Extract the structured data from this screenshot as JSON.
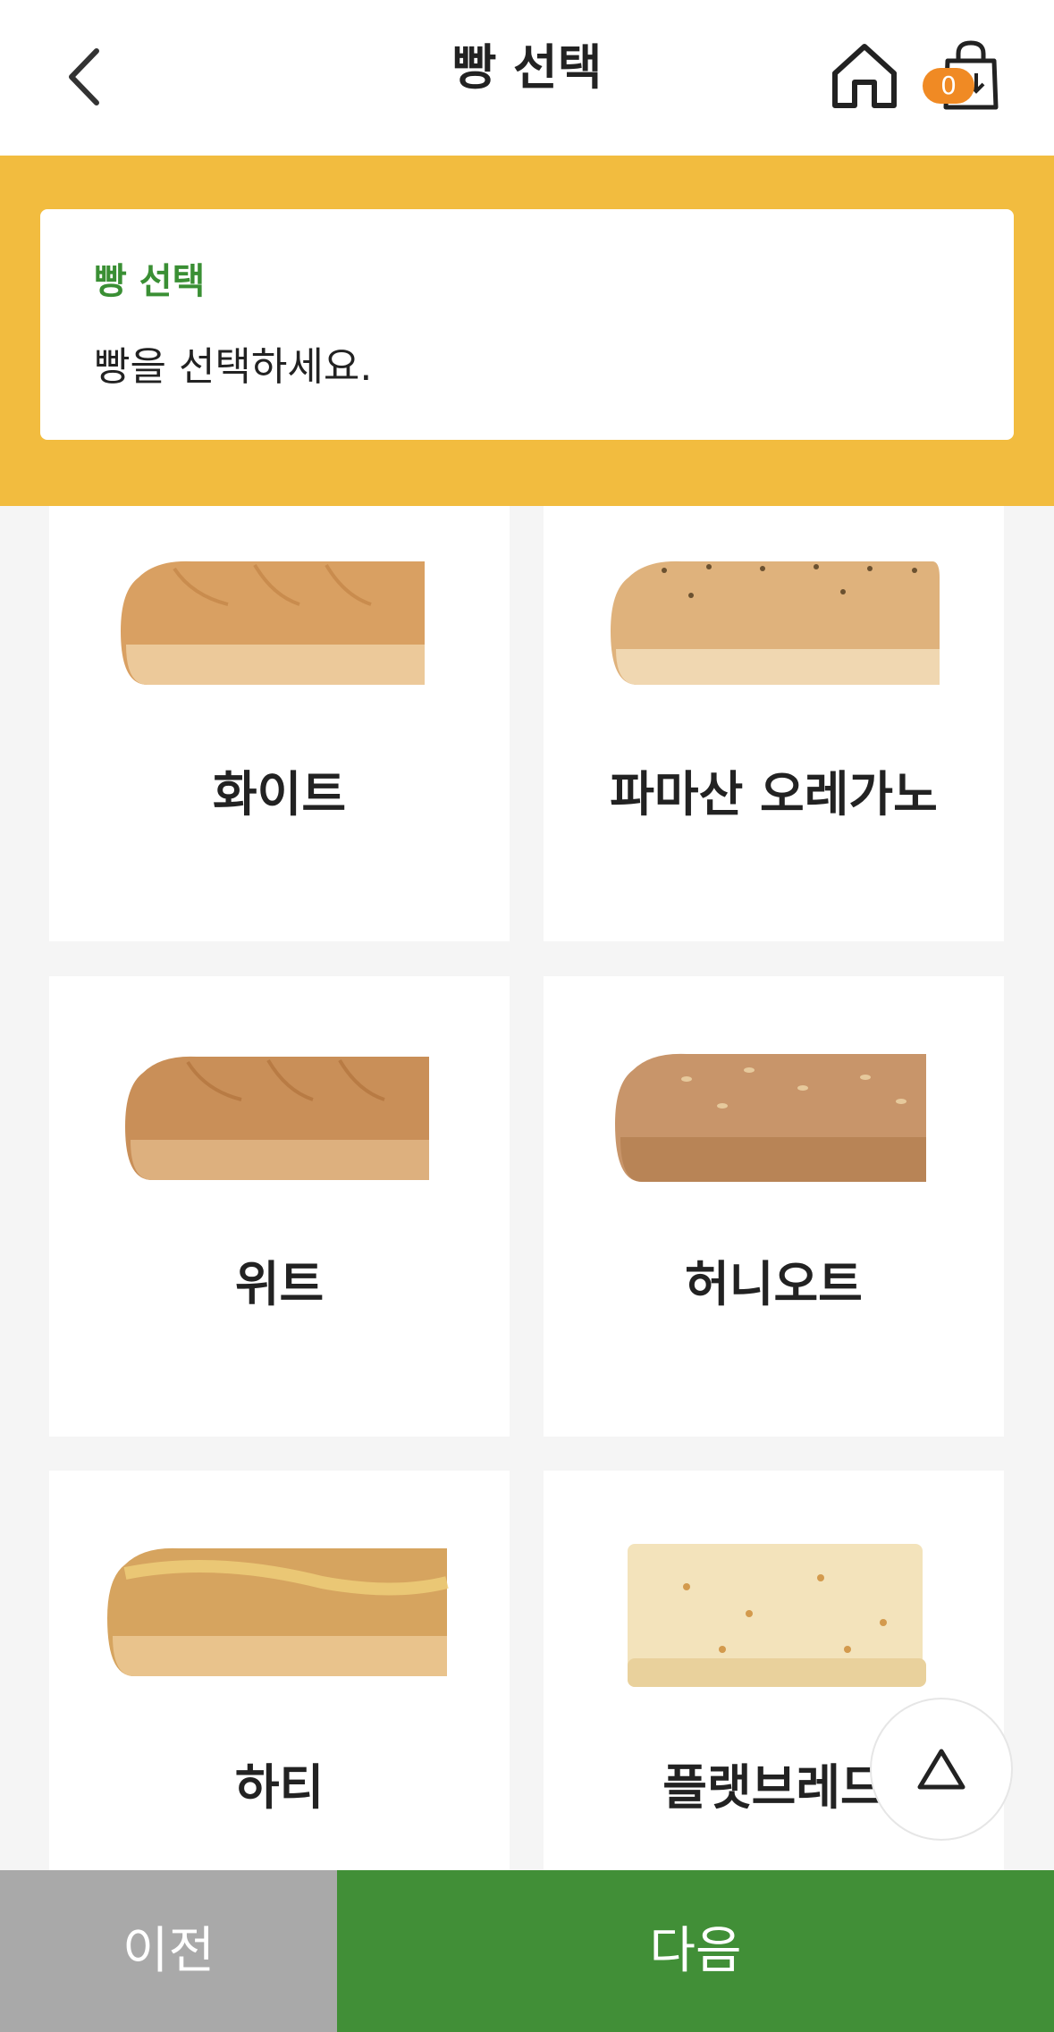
{
  "header": {
    "title": "빵 선택",
    "back_icon": "chevron-left-icon",
    "home_icon": "home-icon",
    "cart_icon": "shopping-bag-icon",
    "cart_count": "0"
  },
  "banner": {
    "title": "빵 선택",
    "description": "빵을 선택하세요."
  },
  "breads": [
    {
      "name": "화이트"
    },
    {
      "name": "파마산 오레가노"
    },
    {
      "name": "위트"
    },
    {
      "name": "허니오트"
    },
    {
      "name": "하티"
    },
    {
      "name": "플랫브레드"
    }
  ],
  "scroll_top_icon": "triangle-up-icon",
  "footer": {
    "prev_label": "이전",
    "next_label": "다음"
  },
  "colors": {
    "banner": "#f2bc3f",
    "accent_green": "#418f37",
    "badge_orange": "#f08a24",
    "prev_gray": "#a9a9a9"
  }
}
